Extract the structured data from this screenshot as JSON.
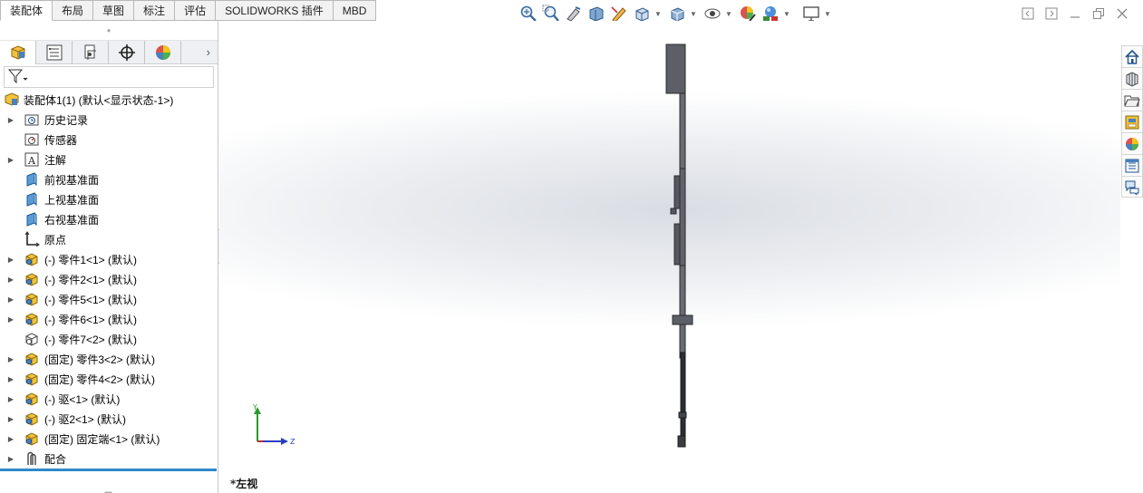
{
  "command_tabs": [
    "装配体",
    "布局",
    "草图",
    "标注",
    "评估",
    "SOLIDWORKS 插件",
    "MBD"
  ],
  "active_tab": "装配体",
  "hud_icons": [
    "zoom-to-fit-icon",
    "zoom-to-area-icon",
    "previous-view-icon",
    "section-view-icon",
    "dynamic-annotation-icon",
    "view-orientation-icon",
    "display-style-icon",
    "hide-show-items-icon",
    "edit-appearance-icon",
    "apply-scene-icon",
    "view-settings-icon"
  ],
  "window_controls": [
    "restore-left-icon",
    "restore-right-icon",
    "minimize-icon",
    "restore-icon",
    "close-icon"
  ],
  "panel_tabs": [
    "featuremanager-icon",
    "propertymanager-icon",
    "configurationmanager-icon",
    "dimxpertmanager-icon",
    "displaymanager-icon"
  ],
  "tree": {
    "root": "装配体1(1)  (默认<显示状态-1>)",
    "items": [
      {
        "label": "历史记录",
        "icon": "history-folder-icon",
        "expandable": true
      },
      {
        "label": "传感器",
        "icon": "sensor-icon",
        "expandable": false
      },
      {
        "label": "注解",
        "icon": "annotation-icon",
        "expandable": true
      },
      {
        "label": "前视基准面",
        "icon": "plane-icon",
        "expandable": false
      },
      {
        "label": "上视基准面",
        "icon": "plane-icon",
        "expandable": false
      },
      {
        "label": "右视基准面",
        "icon": "plane-icon",
        "expandable": false
      },
      {
        "label": "原点",
        "icon": "origin-icon",
        "expandable": false
      },
      {
        "label": "(-) 零件1<1> (默认)",
        "icon": "part-icon",
        "expandable": true
      },
      {
        "label": "(-) 零件2<1> (默认)",
        "icon": "part-icon",
        "expandable": true
      },
      {
        "label": "(-) 零件5<1> (默认)",
        "icon": "part-icon",
        "expandable": true
      },
      {
        "label": "(-) 零件6<1> (默认)",
        "icon": "part-icon",
        "expandable": true
      },
      {
        "label": "(-) 零件7<2> (默认)",
        "icon": "part-outline-icon",
        "expandable": false
      },
      {
        "label": "(固定) 零件3<2> (默认)",
        "icon": "part-icon",
        "expandable": true
      },
      {
        "label": "(固定) 零件4<2> (默认)",
        "icon": "part-icon",
        "expandable": true
      },
      {
        "label": "(-) 驱<1> (默认)",
        "icon": "part-icon",
        "expandable": true
      },
      {
        "label": "(-) 驱2<1> (默认)",
        "icon": "part-icon",
        "expandable": true
      },
      {
        "label": "(固定) 固定端<1> (默认)",
        "icon": "part-icon",
        "expandable": true
      },
      {
        "label": "配合",
        "icon": "mates-icon",
        "expandable": true
      }
    ]
  },
  "viewport": {
    "view_name": "*左视",
    "triad": {
      "y_label": "Y",
      "z_label": "Z"
    }
  },
  "task_pane": [
    "home-icon",
    "design-library-icon",
    "file-explorer-icon",
    "view-palette-icon",
    "appearances-icon",
    "custom-properties-icon",
    "forum-icon"
  ],
  "colors": {
    "accent": "#2f88c8",
    "model": "#5c5f66",
    "model_dark": "#2a2b2f"
  }
}
